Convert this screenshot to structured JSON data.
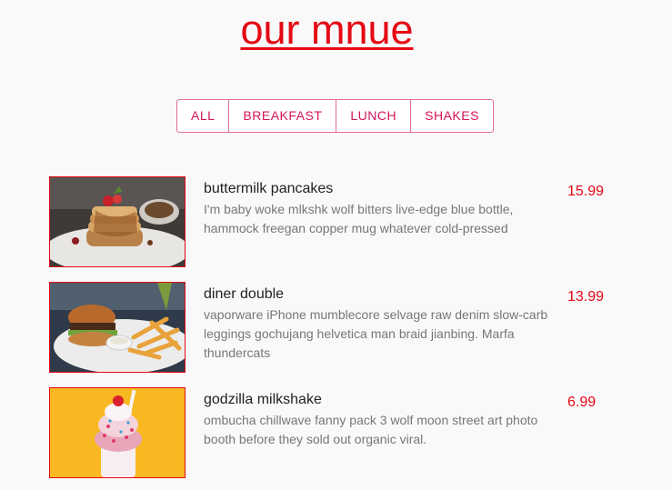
{
  "page_title": "our mnue",
  "filters": [
    "ALL",
    "BREAKFAST",
    "LUNCH",
    "SHAKES"
  ],
  "items": [
    {
      "name": "buttermilk pancakes",
      "description": "I'm baby woke mlkshk wolf bitters live-edge blue bottle, hammock freegan copper mug whatever cold-pressed",
      "price": "15.99",
      "image": "pancakes-photo"
    },
    {
      "name": "diner double",
      "description": "vaporware iPhone mumblecore selvage raw denim slow-carb leggings gochujang helvetica man braid jianbing. Marfa thundercats",
      "price": "13.99",
      "image": "burger-photo"
    },
    {
      "name": "godzilla milkshake",
      "description": "ombucha chillwave fanny pack 3 wolf moon street art photo booth before they sold out organic viral.",
      "price": "6.99",
      "image": "milkshake-photo"
    }
  ],
  "colors": {
    "accent": "#e50914",
    "filter_text": "#d4145a",
    "filter_border": "#e0708c",
    "background": "#f9f9fa"
  }
}
